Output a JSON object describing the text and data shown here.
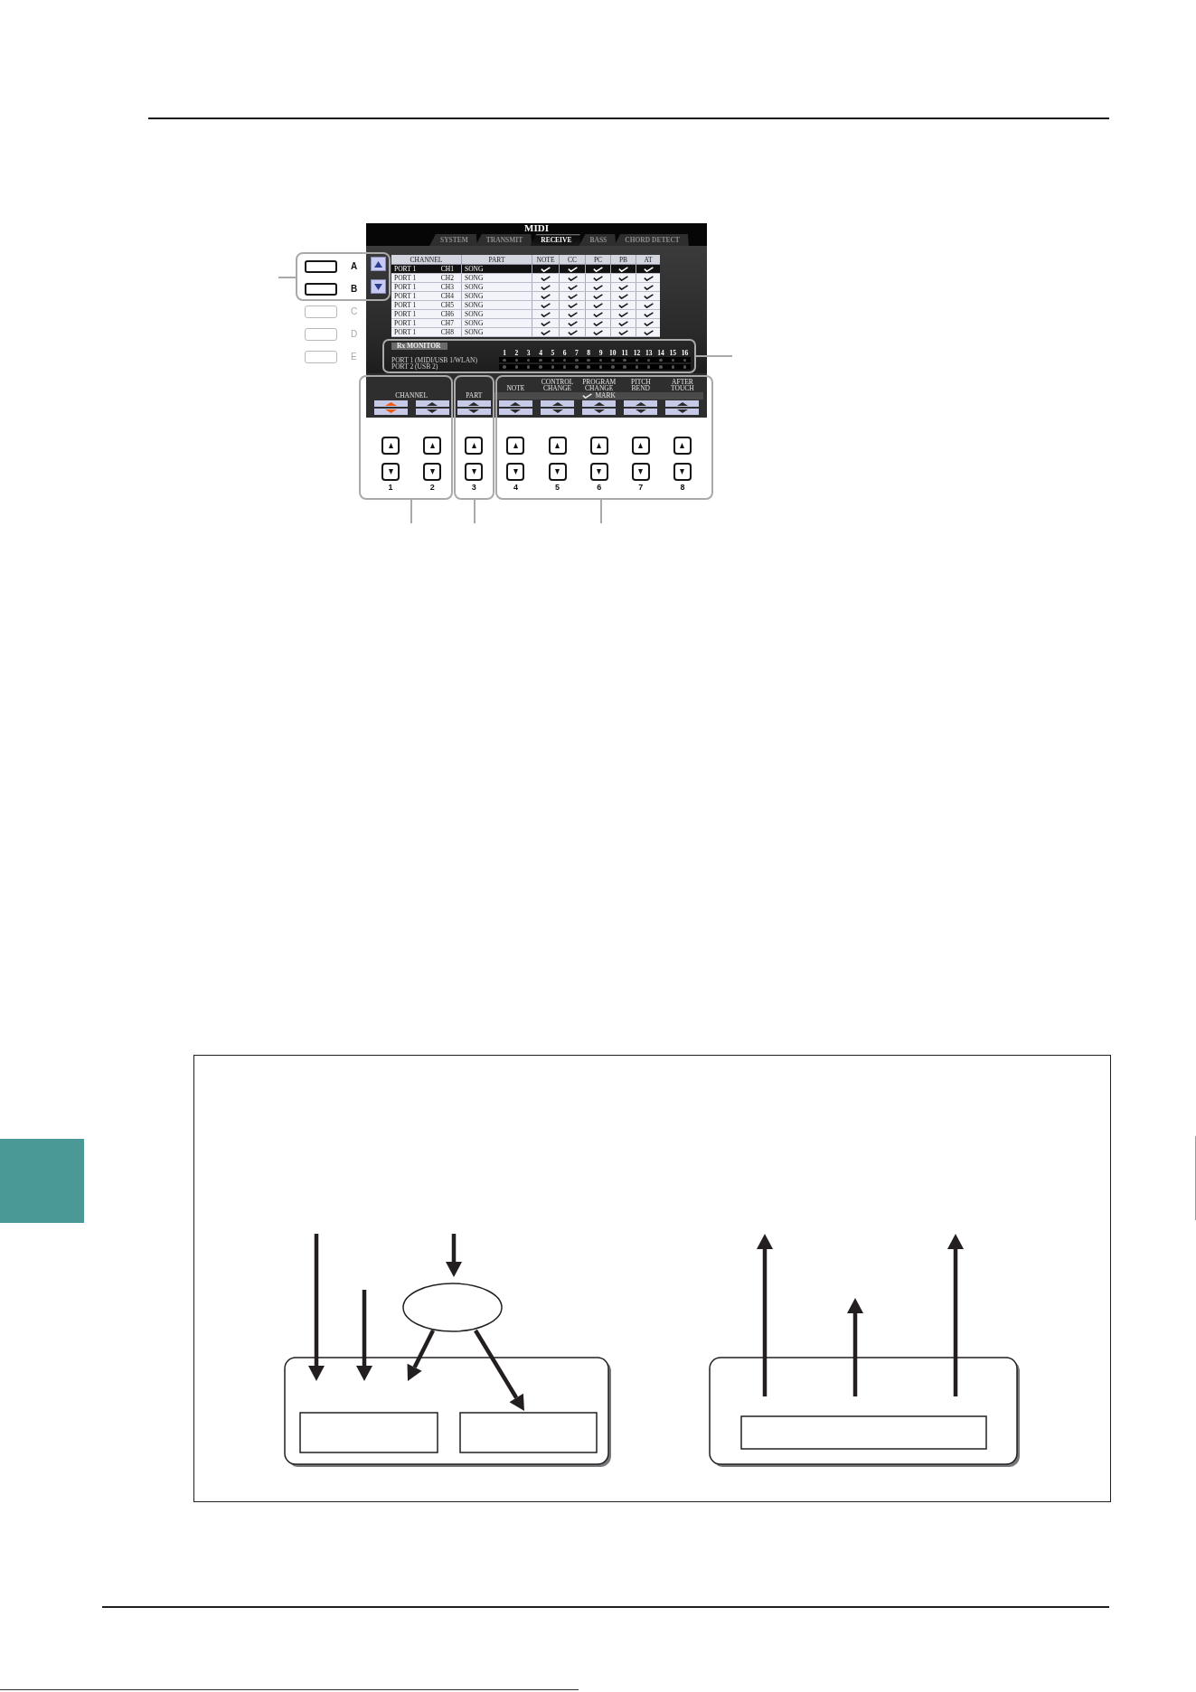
{
  "side_buttons": [
    {
      "label": "A",
      "enabled": true
    },
    {
      "label": "B",
      "enabled": true
    },
    {
      "label": "C",
      "enabled": false
    },
    {
      "label": "D",
      "enabled": false
    },
    {
      "label": "E",
      "enabled": false
    }
  ],
  "screen": {
    "title": "MIDI",
    "tabs": [
      {
        "label": "SYSTEM",
        "selected": false
      },
      {
        "label": "TRANSMIT",
        "selected": false
      },
      {
        "label": "RECEIVE",
        "selected": true
      },
      {
        "label": "BASS",
        "selected": false
      },
      {
        "label": "CHORD DETECT",
        "selected": false
      }
    ],
    "table": {
      "columns": [
        "CHANNEL",
        "PART",
        "NOTE",
        "CC",
        "PC",
        "PB",
        "AT"
      ],
      "rows": [
        {
          "port": "PORT 1",
          "channel": "CH1",
          "part": "SONG",
          "note": true,
          "cc": true,
          "pc": true,
          "pb": true,
          "at": true,
          "selected": true
        },
        {
          "port": "PORT 1",
          "channel": "CH2",
          "part": "SONG",
          "note": true,
          "cc": true,
          "pc": true,
          "pb": true,
          "at": true,
          "selected": false
        },
        {
          "port": "PORT 1",
          "channel": "CH3",
          "part": "SONG",
          "note": true,
          "cc": true,
          "pc": true,
          "pb": true,
          "at": true,
          "selected": false
        },
        {
          "port": "PORT 1",
          "channel": "CH4",
          "part": "SONG",
          "note": true,
          "cc": true,
          "pc": true,
          "pb": true,
          "at": true,
          "selected": false
        },
        {
          "port": "PORT 1",
          "channel": "CH5",
          "part": "SONG",
          "note": true,
          "cc": true,
          "pc": true,
          "pb": true,
          "at": true,
          "selected": false
        },
        {
          "port": "PORT 1",
          "channel": "CH6",
          "part": "SONG",
          "note": true,
          "cc": true,
          "pc": true,
          "pb": true,
          "at": true,
          "selected": false
        },
        {
          "port": "PORT 1",
          "channel": "CH7",
          "part": "SONG",
          "note": true,
          "cc": true,
          "pc": true,
          "pb": true,
          "at": true,
          "selected": false
        },
        {
          "port": "PORT 1",
          "channel": "CH8",
          "part": "SONG",
          "note": true,
          "cc": true,
          "pc": true,
          "pb": true,
          "at": true,
          "selected": false
        }
      ]
    },
    "rx_monitor": {
      "title": "Rx MONITOR",
      "channels": [
        "1",
        "2",
        "3",
        "4",
        "5",
        "6",
        "7",
        "8",
        "9",
        "10",
        "11",
        "12",
        "13",
        "14",
        "15",
        "16"
      ],
      "ports": [
        {
          "label": "PORT 1 (MIDI/USB 1/WLAN)",
          "indicators": [
            {
              "on": false
            },
            {
              "on": false
            },
            {
              "on": false
            },
            {
              "on": false
            },
            {
              "on": false
            },
            {
              "on": false
            },
            {
              "on": false
            },
            {
              "on": false
            },
            {
              "on": false
            },
            {
              "on": false
            },
            {
              "on": false
            },
            {
              "on": false
            },
            {
              "on": false
            },
            {
              "on": false
            },
            {
              "on": false
            },
            {
              "on": false
            }
          ]
        },
        {
          "label": "PORT 2 (USB 2)",
          "indicators": [
            {
              "on": false
            },
            {
              "on": false
            },
            {
              "on": false
            },
            {
              "on": false
            },
            {
              "on": false
            },
            {
              "on": false
            },
            {
              "on": false
            },
            {
              "on": false
            },
            {
              "on": false
            },
            {
              "on": false
            },
            {
              "on": false
            },
            {
              "on": false
            },
            {
              "on": false
            },
            {
              "on": false
            },
            {
              "on": false
            },
            {
              "on": false
            }
          ]
        }
      ]
    },
    "control_groups": [
      {
        "kind": "plain",
        "label": "CHANNEL",
        "controls": [
          {
            "selected": true
          },
          {
            "selected": false
          }
        ]
      },
      {
        "kind": "plain",
        "label": "PART",
        "controls": [
          {
            "selected": false
          }
        ]
      },
      {
        "kind": "mark",
        "label": "MARK",
        "controls": [
          {
            "label": "NOTE",
            "selected": false
          },
          {
            "label": "CONTROL CHANGE",
            "selected": false
          },
          {
            "label": "PROGRAM CHANGE",
            "selected": false
          },
          {
            "label": "PITCH BEND",
            "selected": false
          },
          {
            "label": "AFTER TOUCH",
            "selected": false
          }
        ]
      }
    ]
  },
  "panel_buttons": [
    "1",
    "2",
    "3",
    "4",
    "5",
    "6",
    "7",
    "8"
  ]
}
